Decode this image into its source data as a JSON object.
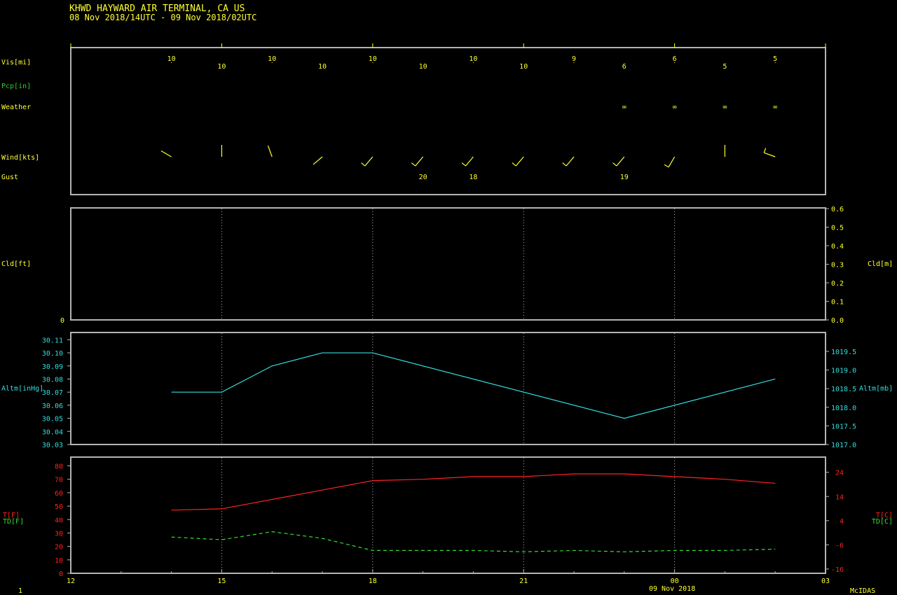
{
  "title": "KHWD  HAYWARD AIR TERMINAL, CA US",
  "subtitle": "08 Nov 2018/14UTC - 09 Nov 2018/02UTC",
  "footer": {
    "page_number": "1",
    "date_label": "09 Nov 2018",
    "software": "McIDAS"
  },
  "colors": {
    "background": "#000000",
    "frame": "#b4b4b4",
    "text_yellow": "#ffff33",
    "pcp_green": "#33cc33",
    "altimeter_cyan": "#33dddd",
    "temp_red": "#ff2222",
    "dewpoint_green": "#33dd33",
    "grid": "#b4b4b4"
  },
  "chart_data": [
    {
      "type": "table",
      "panel": "surface-obs",
      "row_labels": {
        "vis": "Vis[mi]",
        "pcp": "Pcp[in]",
        "weather": "Weather",
        "wind": "Wind[kts]",
        "gust": "Gust"
      },
      "hours": [
        14,
        15,
        16,
        17,
        18,
        19,
        20,
        21,
        22,
        23,
        24,
        25,
        26
      ],
      "visibility": [
        "10",
        "10",
        "10",
        "10",
        "10",
        "10",
        "10",
        "10",
        "9",
        "6",
        "6",
        "5",
        "5"
      ],
      "weather_symbol": "∞",
      "weather_hours": [
        23,
        24,
        25,
        26
      ],
      "wind": [
        {
          "hour": 14,
          "dir": 300,
          "kind": "shaft"
        },
        {
          "hour": 15,
          "dir": 360,
          "kind": "shaft"
        },
        {
          "hour": 16,
          "dir": 340,
          "kind": "shaft"
        },
        {
          "hour": 17,
          "dir": 230,
          "kind": "shaft"
        },
        {
          "hour": 18,
          "dir": 220,
          "kind": "barb"
        },
        {
          "hour": 19,
          "dir": 220,
          "kind": "barb"
        },
        {
          "hour": 20,
          "dir": 220,
          "kind": "barb"
        },
        {
          "hour": 21,
          "dir": 220,
          "kind": "barb"
        },
        {
          "hour": 22,
          "dir": 220,
          "kind": "barb"
        },
        {
          "hour": 23,
          "dir": 220,
          "kind": "barb"
        },
        {
          "hour": 24,
          "dir": 210,
          "kind": "barb"
        },
        {
          "hour": 25,
          "dir": 360,
          "kind": "shaft"
        },
        {
          "hour": 26,
          "dir": 290,
          "kind": "barb"
        }
      ],
      "gusts": [
        {
          "hour": 19,
          "value": "20"
        },
        {
          "hour": 20,
          "value": "18"
        },
        {
          "hour": 23,
          "value": "19"
        }
      ]
    },
    {
      "type": "line",
      "panel": "cloud",
      "ylabel_left": "Cld[ft]",
      "ylabel_right": "Cld[m]",
      "left_ticks": [
        "0"
      ],
      "right_ticks": [
        "0.0",
        "0.1",
        "0.2",
        "0.3",
        "0.4",
        "0.5",
        "0.6"
      ],
      "ylim_right": [
        0,
        0.6
      ],
      "series": []
    },
    {
      "type": "line",
      "panel": "altimeter",
      "ylabel_left": "Altm[inHg]",
      "ylabel_right": "Altm[mb]",
      "left_ticks": [
        "30.03",
        "30.04",
        "30.05",
        "30.06",
        "30.07",
        "30.08",
        "30.09",
        "30.10",
        "30.11"
      ],
      "ylim_left": [
        30.03,
        30.115
      ],
      "right_ticks": [
        "1017.0",
        "1017.5",
        "1018.0",
        "1018.5",
        "1019.0",
        "1019.5"
      ],
      "ylim_right": [
        1017.0,
        1019.5
      ],
      "x": [
        14,
        15,
        16,
        17,
        18,
        23,
        26
      ],
      "values": [
        30.07,
        30.07,
        30.09,
        30.1,
        30.1,
        30.05,
        30.08
      ]
    },
    {
      "type": "line",
      "panel": "temperature",
      "ylabel_left_t": "T[F]",
      "ylabel_left_td": "TD[F]",
      "ylabel_right_t": "T[C]",
      "ylabel_right_td": "TD[C]",
      "left_ticks": [
        "0",
        "10",
        "20",
        "30",
        "40",
        "50",
        "60",
        "70",
        "80"
      ],
      "ylim_left": [
        0,
        86
      ],
      "right_ticks": [
        "-16",
        "-6",
        "4",
        "14",
        "24"
      ],
      "xlim": [
        12,
        27
      ],
      "x_ticks": [
        "12",
        "15",
        "18",
        "21",
        "00",
        "03"
      ],
      "series": [
        {
          "name": "T",
          "x": [
            14,
            15,
            16,
            17,
            18,
            19,
            20,
            21,
            22,
            23,
            24,
            25,
            26
          ],
          "values": [
            47,
            48,
            55,
            62,
            69,
            70,
            72,
            72,
            74,
            74,
            72,
            70,
            67
          ]
        },
        {
          "name": "TD",
          "x": [
            14,
            15,
            16,
            17,
            18,
            19,
            20,
            21,
            22,
            23,
            24,
            25,
            26
          ],
          "values": [
            27,
            25,
            31,
            26,
            17,
            17,
            17,
            16,
            17,
            16,
            17,
            17,
            18
          ]
        }
      ]
    }
  ]
}
